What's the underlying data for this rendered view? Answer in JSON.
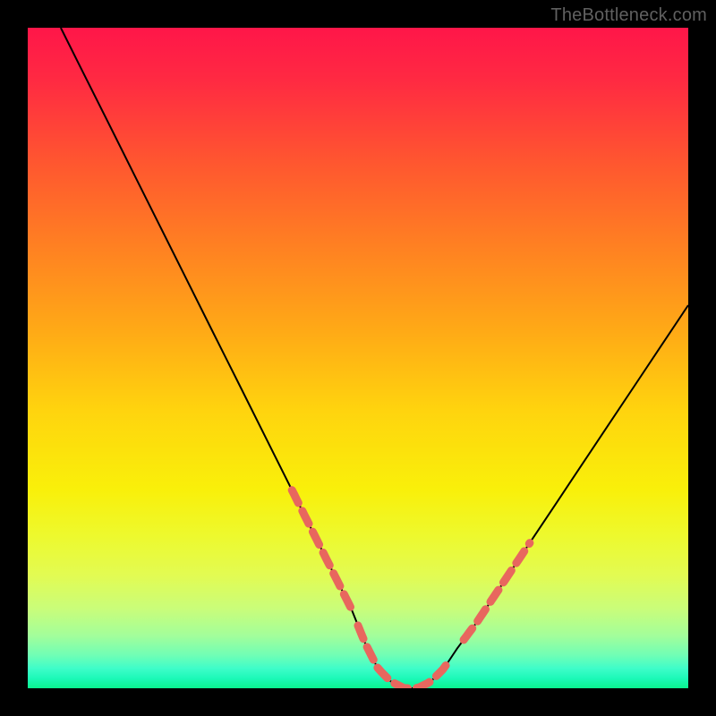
{
  "watermark": "TheBottleneck.com",
  "gradient": {
    "stops": [
      {
        "offset": 0.0,
        "color": "#ff1649"
      },
      {
        "offset": 0.08,
        "color": "#ff2a42"
      },
      {
        "offset": 0.2,
        "color": "#ff5530"
      },
      {
        "offset": 0.33,
        "color": "#ff8022"
      },
      {
        "offset": 0.46,
        "color": "#ffaa16"
      },
      {
        "offset": 0.58,
        "color": "#ffd40e"
      },
      {
        "offset": 0.7,
        "color": "#f9f00a"
      },
      {
        "offset": 0.77,
        "color": "#edf92e"
      },
      {
        "offset": 0.83,
        "color": "#e2fb53"
      },
      {
        "offset": 0.88,
        "color": "#c9fd7a"
      },
      {
        "offset": 0.92,
        "color": "#a3fe9a"
      },
      {
        "offset": 0.95,
        "color": "#70feb5"
      },
      {
        "offset": 0.97,
        "color": "#3efdc9"
      },
      {
        "offset": 0.985,
        "color": "#1cf9b8"
      },
      {
        "offset": 1.0,
        "color": "#0af38e"
      }
    ]
  },
  "chart_data": {
    "type": "line",
    "title": "",
    "xlabel": "",
    "ylabel": "",
    "xlim": [
      0,
      100
    ],
    "ylim": [
      0,
      100
    ],
    "curve_comment": "V-shaped bottleneck curve; y is percentage height from bottom; minimum ≈0 around x=53..62",
    "x": [
      5,
      8,
      12,
      16,
      20,
      24,
      28,
      32,
      36,
      40,
      43,
      46,
      49,
      51,
      53,
      55,
      57,
      59,
      61,
      63,
      65,
      68,
      72,
      76,
      80,
      84,
      88,
      92,
      96,
      100
    ],
    "y": [
      100,
      94,
      86,
      78,
      70,
      62,
      54,
      46,
      38,
      30,
      24,
      18,
      12,
      7,
      3,
      1,
      0,
      0,
      1,
      3,
      6,
      10,
      16,
      22,
      28,
      34,
      40,
      46,
      52,
      58
    ],
    "highlight_segments_comment": "salmon overlay segments (thicker dashed) — approximate x ranges on each arm near the trough",
    "highlight_segments": [
      {
        "x_start": 40,
        "x_end": 49
      },
      {
        "x_start": 50,
        "x_end": 64
      },
      {
        "x_start": 66,
        "x_end": 76
      }
    ],
    "highlight_color": "#e8675e",
    "curve_color": "#000000"
  }
}
